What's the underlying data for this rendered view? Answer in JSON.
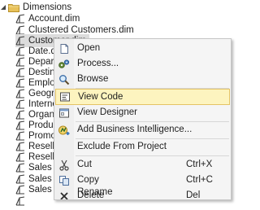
{
  "tree": {
    "folder": {
      "label": "Dimensions",
      "icon": "folder-icon",
      "expanded": true
    },
    "items": [
      {
        "label": "Account.dim"
      },
      {
        "label": "Clustered Customers.dim"
      },
      {
        "label": "Customer.dim",
        "selected": true
      },
      {
        "label": "Date.dim"
      },
      {
        "label": "Departm"
      },
      {
        "label": "Destinati"
      },
      {
        "label": "Employe"
      },
      {
        "label": "Geograp"
      },
      {
        "label": "Internet"
      },
      {
        "label": "Organiz"
      },
      {
        "label": "Product"
      },
      {
        "label": "Promoti"
      },
      {
        "label": "Reseller"
      },
      {
        "label": "Reseller"
      },
      {
        "label": "Sales Ch"
      },
      {
        "label": "Sales Re"
      },
      {
        "label": "Sales Su"
      }
    ]
  },
  "context_menu": {
    "items": [
      {
        "label": "Open",
        "shortcut": "",
        "icon": "open-icon"
      },
      {
        "label": "Process...",
        "shortcut": "",
        "icon": "process-icon"
      },
      {
        "label": "Browse",
        "shortcut": "",
        "icon": "browse-icon"
      },
      {
        "label": "View Code",
        "shortcut": "",
        "icon": "view-code-icon",
        "highlighted": true
      },
      {
        "label": "View Designer",
        "shortcut": "",
        "icon": "view-designer-icon"
      },
      {
        "label": "Add Business Intelligence...",
        "shortcut": "",
        "icon": "business-intelligence-icon"
      },
      {
        "label": "Exclude From Project",
        "shortcut": "",
        "icon": ""
      },
      {
        "label": "Cut",
        "shortcut": "Ctrl+X",
        "icon": "cut-icon"
      },
      {
        "label": "Copy",
        "shortcut": "Ctrl+C",
        "icon": "copy-icon"
      },
      {
        "label": "Delete",
        "shortcut": "Del",
        "icon": "delete-icon"
      },
      {
        "label": "Rename",
        "shortcut": "",
        "icon": ""
      }
    ]
  },
  "colors": {
    "menu_background": "#f5f5f5",
    "menu_highlight": "#fdf4bf",
    "menu_highlight_border": "#e5c365",
    "selection_background": "#dcdcdc",
    "folder_yellow": "#e8c25a"
  }
}
